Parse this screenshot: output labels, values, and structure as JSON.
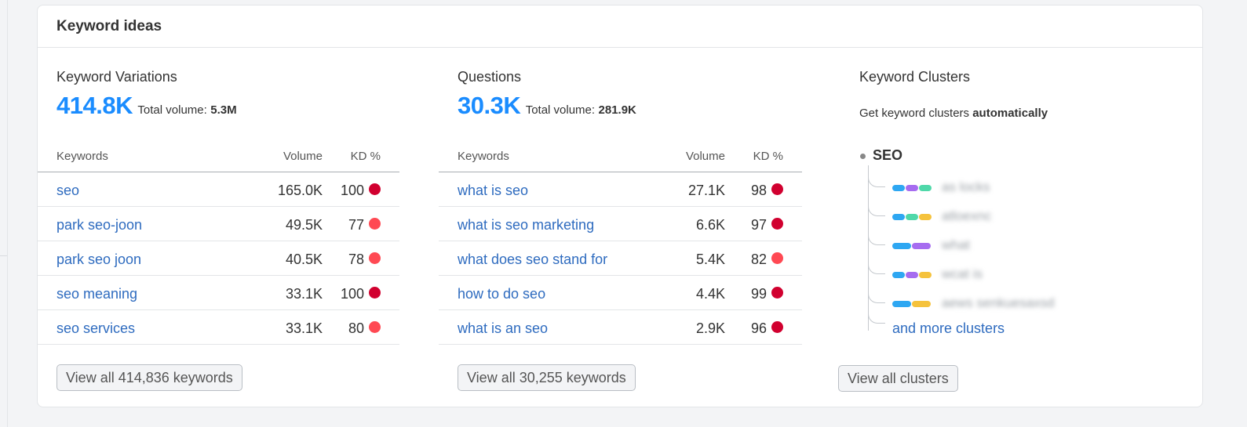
{
  "title": "Keyword ideas",
  "variations": {
    "title": "Keyword Variations",
    "count": "414.8K",
    "total_label": "Total volume:",
    "total_value": "5.3M",
    "headers": {
      "keywords": "Keywords",
      "volume": "Volume",
      "kd": "KD %"
    },
    "rows": [
      {
        "keyword": "seo",
        "volume": "165.0K",
        "kd": "100",
        "kd_color": "#d1002f"
      },
      {
        "keyword": "park seo-joon",
        "volume": "49.5K",
        "kd": "77",
        "kd_color": "#ff4953"
      },
      {
        "keyword": "park seo joon",
        "volume": "40.5K",
        "kd": "78",
        "kd_color": "#ff4953"
      },
      {
        "keyword": "seo meaning",
        "volume": "33.1K",
        "kd": "100",
        "kd_color": "#d1002f"
      },
      {
        "keyword": "seo services",
        "volume": "33.1K",
        "kd": "80",
        "kd_color": "#ff4953"
      }
    ],
    "button": "View all 414,836 keywords"
  },
  "questions": {
    "title": "Questions",
    "count": "30.3K",
    "total_label": "Total volume:",
    "total_value": "281.9K",
    "headers": {
      "keywords": "Keywords",
      "volume": "Volume",
      "kd": "KD %"
    },
    "rows": [
      {
        "keyword": "what is seo",
        "volume": "27.1K",
        "kd": "98",
        "kd_color": "#d1002f"
      },
      {
        "keyword": "what is seo marketing",
        "volume": "6.6K",
        "kd": "97",
        "kd_color": "#d1002f"
      },
      {
        "keyword": "what does seo stand for",
        "volume": "5.4K",
        "kd": "82",
        "kd_color": "#ff4953"
      },
      {
        "keyword": "how to do seo",
        "volume": "4.4K",
        "kd": "99",
        "kd_color": "#d1002f"
      },
      {
        "keyword": "what is an seo",
        "volume": "2.9K",
        "kd": "96",
        "kd_color": "#d1002f"
      }
    ],
    "button": "View all 30,255 keywords"
  },
  "clusters": {
    "title": "Keyword Clusters",
    "subtitle_prefix": "Get keyword clusters",
    "subtitle_bold": "automatically",
    "root": "SEO",
    "items": [
      {
        "label": "as locks",
        "segments": [
          "#2ea7f2",
          "#a66cf0",
          "#4fd8a9"
        ]
      },
      {
        "label": "atloexnc",
        "segments": [
          "#2ea7f2",
          "#4fd8a9",
          "#f5c23c"
        ]
      },
      {
        "label": "what",
        "segments": [
          "#2ea7f2",
          "#a66cf0"
        ]
      },
      {
        "label": "wcat is",
        "segments": [
          "#2ea7f2",
          "#a66cf0",
          "#f5c23c"
        ]
      },
      {
        "label": "aews senkuesaxsd",
        "segments": [
          "#2ea7f2",
          "#f5c23c"
        ]
      }
    ],
    "more": "and more clusters",
    "button": "View all clusters"
  }
}
